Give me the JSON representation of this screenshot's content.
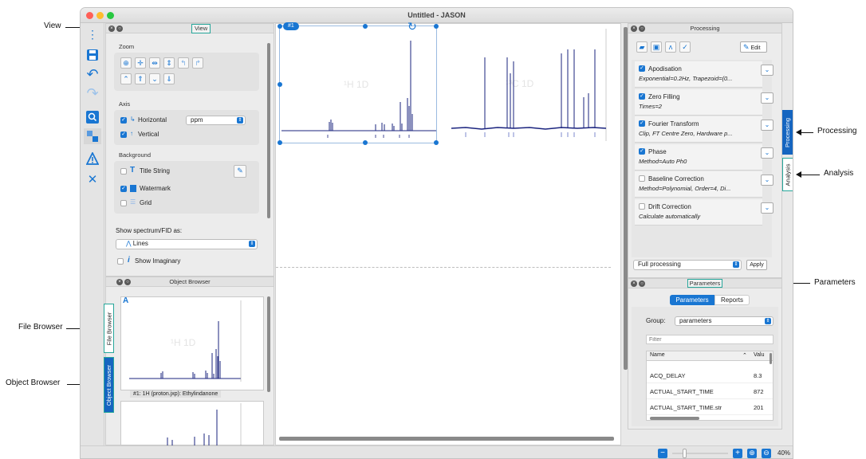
{
  "window": {
    "title": "Untitled - JASON"
  },
  "callouts": {
    "view": "View",
    "file_browser": "File Browser",
    "object_browser": "Object Browser",
    "processing": "Processing",
    "analysis": "Analysis",
    "parameters": "Parameters"
  },
  "view_panel": {
    "tab": "View",
    "zoom_label": "Zoom",
    "axis_label": "Axis",
    "horizontal": "Horizontal",
    "unit": "ppm",
    "vertical": "Vertical",
    "background_label": "Background",
    "title_string": "Title String",
    "watermark": "Watermark",
    "grid": "Grid",
    "show_as_label": "Show spectrum/FID as:",
    "show_as_value": "Lines",
    "show_imaginary": "Show Imaginary"
  },
  "object_browser": {
    "title": "Object Browser",
    "side_tab_file": "File Browser",
    "side_tab_object": "Object Browser",
    "thumb_letter": "A",
    "thumb_watermark": "¹H 1D",
    "caption": "#1: 1H (proton.jxp): Ethylindanone"
  },
  "spectra": {
    "badge": "#1",
    "left_watermark": "¹H 1D",
    "right_watermark": "¹³C 1D"
  },
  "processing": {
    "title": "Processing",
    "edit": "Edit",
    "steps": [
      {
        "name": "Apodisation",
        "detail": "Exponential=0.2Hz, Trapezoid=(0...",
        "checked": true
      },
      {
        "name": "Zero Filling",
        "detail": "Times=2",
        "checked": true
      },
      {
        "name": "Fourier Transform",
        "detail": "Clip, FT Centre Zero, Hardware p...",
        "checked": true
      },
      {
        "name": "Phase",
        "detail": "Method=Auto Ph0",
        "checked": true
      },
      {
        "name": "Baseline Correction",
        "detail": "Method=Polynomial, Order=4, Di...",
        "checked": false
      },
      {
        "name": "Drift Correction",
        "detail": "Calculate automatically",
        "checked": false
      }
    ],
    "mode": "Full processing",
    "apply": "Apply",
    "side_tab_processing": "Processing",
    "side_tab_analysis": "Analysis"
  },
  "parameters": {
    "title": "Parameters",
    "tab_parameters": "Parameters",
    "tab_reports": "Reports",
    "group_label": "Group:",
    "group_value": "parameters",
    "filter_placeholder": "Filter",
    "col_name": "Name",
    "col_value": "Valu",
    "rows": [
      {
        "name": "ACQ_DELAY",
        "value": "8.3"
      },
      {
        "name": "ACTUAL_START_TIME",
        "value": "872"
      },
      {
        "name": "ACTUAL_START_TIME.str",
        "value": "201"
      }
    ]
  },
  "statusbar": {
    "zoom_percent": "40%"
  }
}
